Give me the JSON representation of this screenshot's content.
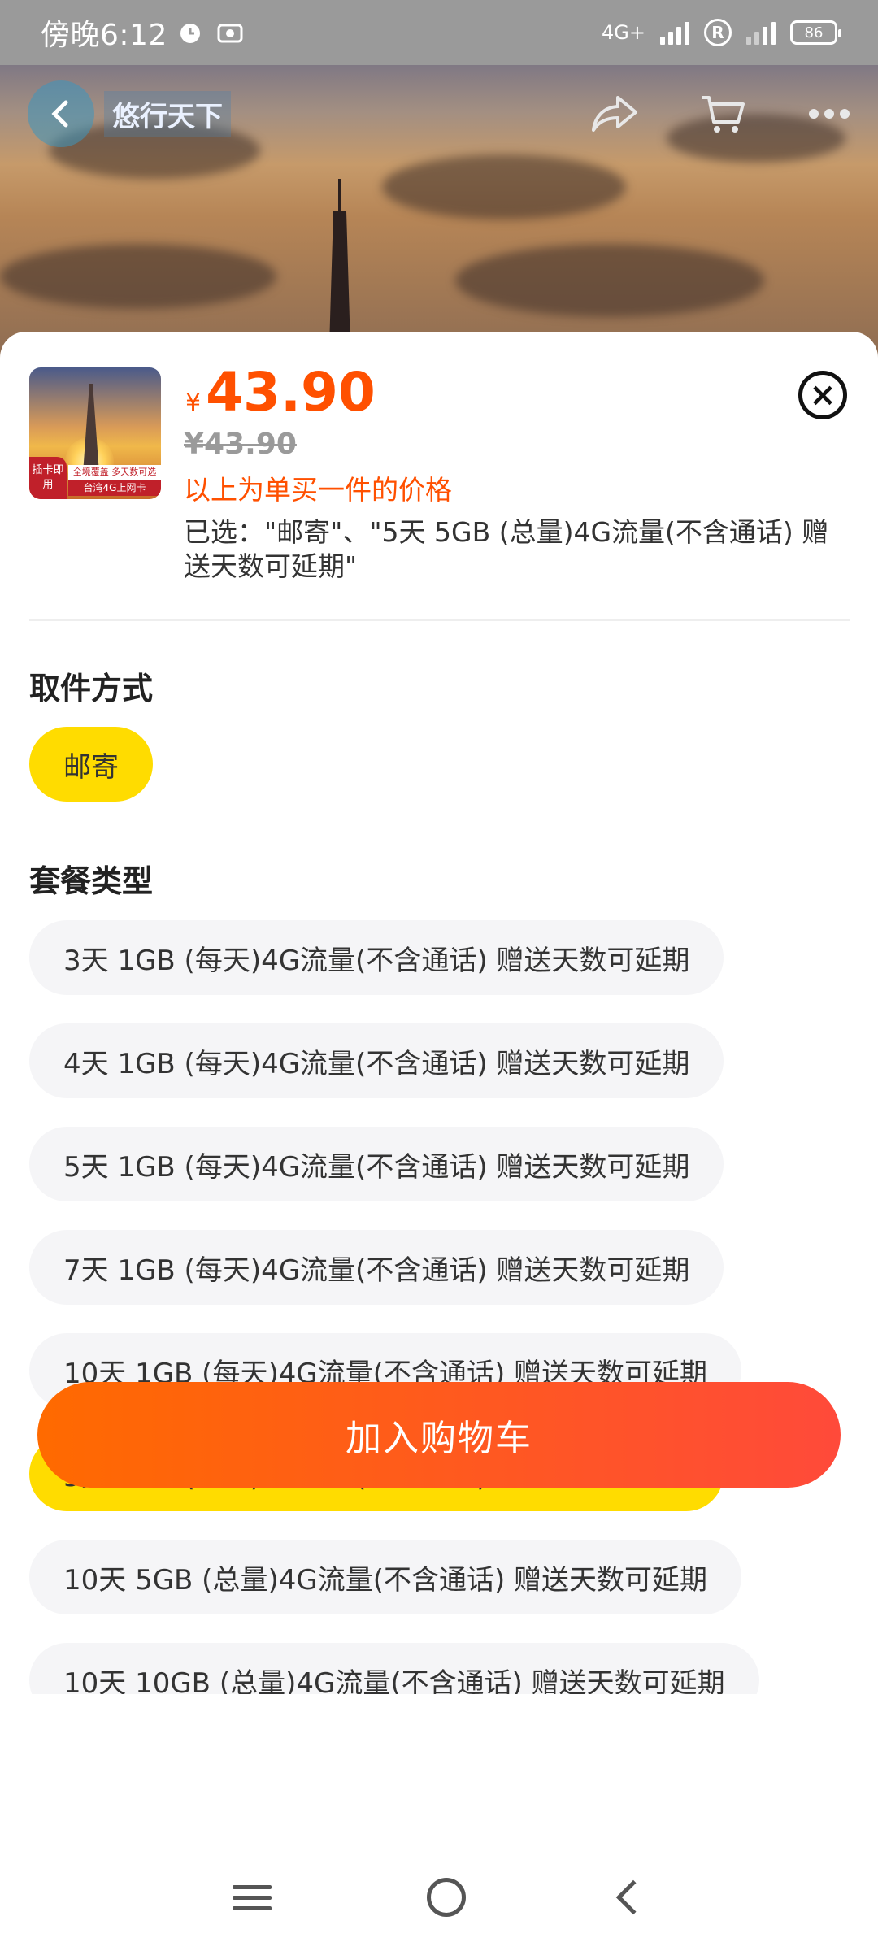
{
  "status_bar": {
    "time": "傍晚6:12",
    "network": "4G+",
    "roaming": "R",
    "battery": "86"
  },
  "header": {
    "logo_text": "悠行天下",
    "actions": [
      "share-icon",
      "cart-icon",
      "more-icon"
    ]
  },
  "product": {
    "thumbnail_tag": "插卡即用",
    "thumbnail_band1": "全境覆盖 多天数可选",
    "thumbnail_band2": "台湾4G上网卡",
    "currency": "¥",
    "price": "43.90",
    "original_price": "¥43.90",
    "price_note": "以上为单买一件的价格",
    "selected": "已选：\"邮寄\"、\"5天 5GB (总量)4G流量(不含通话) 赠送天数可延期\""
  },
  "pickup": {
    "title": "取件方式",
    "options": [
      {
        "label": "邮寄",
        "selected": true
      }
    ]
  },
  "package": {
    "title": "套餐类型",
    "options": [
      {
        "label": "3天 1GB (每天)4G流量(不含通话) 赠送天数可延期",
        "selected": false
      },
      {
        "label": "4天 1GB (每天)4G流量(不含通话) 赠送天数可延期",
        "selected": false
      },
      {
        "label": "5天 1GB (每天)4G流量(不含通话) 赠送天数可延期",
        "selected": false
      },
      {
        "label": "7天 1GB (每天)4G流量(不含通话) 赠送天数可延期",
        "selected": false
      },
      {
        "label": "10天 1GB (每天)4G流量(不含通话) 赠送天数可延期",
        "selected": false
      },
      {
        "label": "5天 5GB (总量)4G流量(不含通话) 赠送天数可延期",
        "selected": true
      },
      {
        "label": "10天 5GB (总量)4G流量(不含通话) 赠送天数可延期",
        "selected": false
      },
      {
        "label": "10天 10GB (总量)4G流量(不含通话) 赠送天数可延期",
        "selected": false
      }
    ]
  },
  "cart_button": "加入购物车",
  "colors": {
    "price": "#ff5000",
    "selected_chip": "#ffdc00",
    "chip_bg": "#f5f5f7",
    "cta_start": "#ff6a00",
    "cta_end": "#ff4a3a"
  }
}
